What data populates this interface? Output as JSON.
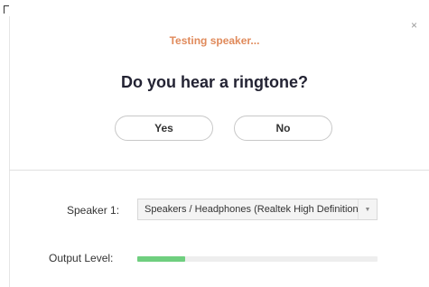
{
  "dialog": {
    "close_symbol": "×",
    "status_text": "Testing speaker...",
    "question": "Do you hear a ringtone?",
    "yes_label": "Yes",
    "no_label": "No"
  },
  "speaker": {
    "label": "Speaker 1:",
    "selected_device": "Speakers / Headphones (Realtek High Definition Audio)",
    "dropdown_icon": "chevron-down-icon"
  },
  "output_level": {
    "label": "Output Level:",
    "level_fraction": 0.2
  },
  "colors": {
    "status_text": "#e08a5b",
    "level_fill": "#6fcf7f"
  }
}
